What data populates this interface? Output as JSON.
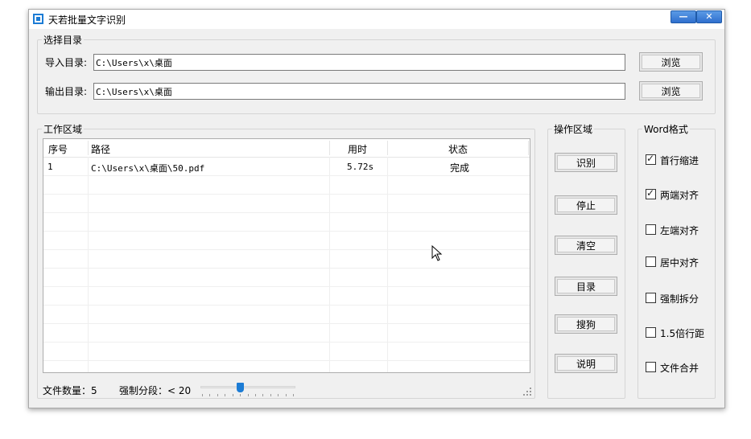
{
  "window": {
    "title": "天若批量文字识别",
    "min_label": "—",
    "close_label": "✕"
  },
  "select_dir": {
    "legend": "选择目录",
    "import_label": "导入目录:",
    "import_value": "C:\\Users\\x\\桌面",
    "export_label": "输出目录:",
    "export_value": "C:\\Users\\x\\桌面",
    "browse_label": "浏览"
  },
  "work_area": {
    "legend": "工作区域",
    "columns": [
      "序号",
      "路径",
      "用时",
      "状态"
    ],
    "rows": [
      {
        "index": "1",
        "path": "C:\\Users\\x\\桌面\\50.pdf",
        "time": "5.72s",
        "status": "完成"
      }
    ],
    "file_count_label": "文件数量：5",
    "split_label": "强制分段：< 20",
    "slider_value": 5,
    "slider_max": 12
  },
  "operation": {
    "legend": "操作区域",
    "buttons": [
      "识别",
      "停止",
      "清空",
      "目录",
      "搜狗",
      "说明"
    ]
  },
  "word_format": {
    "legend": "Word格式",
    "options": [
      {
        "label": "首行缩进",
        "checked": true
      },
      {
        "label": "两端对齐",
        "checked": true
      },
      {
        "label": "左端对齐",
        "checked": false
      },
      {
        "label": "居中对齐",
        "checked": false
      },
      {
        "label": "强制拆分",
        "checked": false
      },
      {
        "label": "1.5倍行距",
        "checked": false
      },
      {
        "label": "文件合并",
        "checked": false
      }
    ]
  },
  "colors": {
    "accent": "#1c7cd5",
    "window_bg": "#f0f0f0"
  }
}
